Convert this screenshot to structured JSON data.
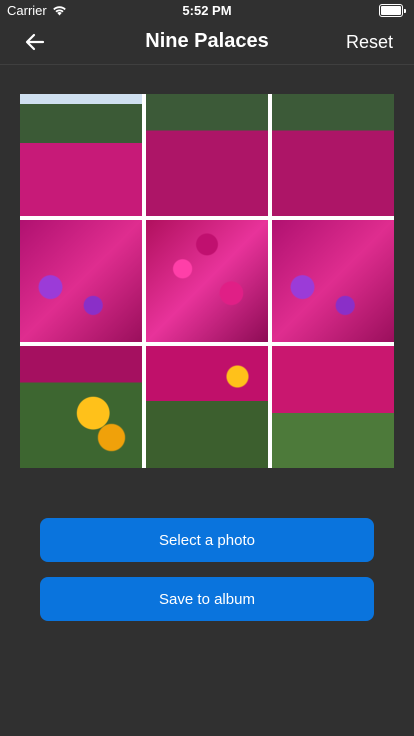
{
  "status_bar": {
    "carrier": "Carrier",
    "time": "5:52 PM",
    "battery_level": 1.0
  },
  "nav": {
    "back_icon": "arrow-left-icon",
    "title": "Nine Palaces",
    "reset_label": "Reset"
  },
  "grid": {
    "rows": 3,
    "columns": 3,
    "image_description_visible": false
  },
  "actions": {
    "select_label": "Select a photo",
    "save_label": "Save to album"
  },
  "colors": {
    "background": "#303030",
    "button": "#0a74dd",
    "grid_lines": "#ffffff"
  }
}
